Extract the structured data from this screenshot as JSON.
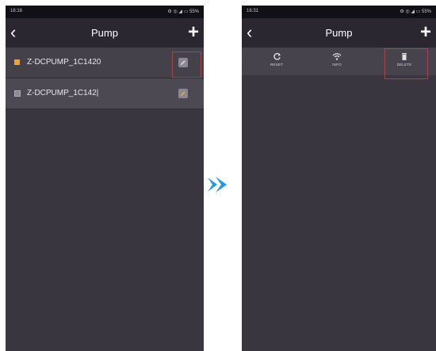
{
  "left_screen": {
    "status_time": "16:16",
    "status_icons": "⚙ ◎ ◢ ▭ 55%",
    "title": "Pump",
    "back_glyph": "‹",
    "add_glyph": "+",
    "devices": [
      {
        "name": "Z-DCPUMP_1C1420",
        "indicator_color": "#e9a637"
      },
      {
        "name": "Z-DCPUMP_1C142|",
        "indicator_color": "#8f8b96"
      }
    ]
  },
  "right_screen": {
    "status_time": "16:31",
    "status_icons": "⚙ ◎ ◢ ▭ 55%",
    "title": "Pump",
    "back_glyph": "‹",
    "add_glyph": "+",
    "actions": [
      {
        "label": "RESET",
        "icon": "refresh-icon"
      },
      {
        "label": "INFO",
        "icon": "wifi-icon"
      },
      {
        "label": "DELETE",
        "icon": "trash-icon"
      }
    ]
  },
  "colors": {
    "highlight": "#e22a2a",
    "arrow": "#1e9be5",
    "screen_bg": "#3a3640"
  }
}
